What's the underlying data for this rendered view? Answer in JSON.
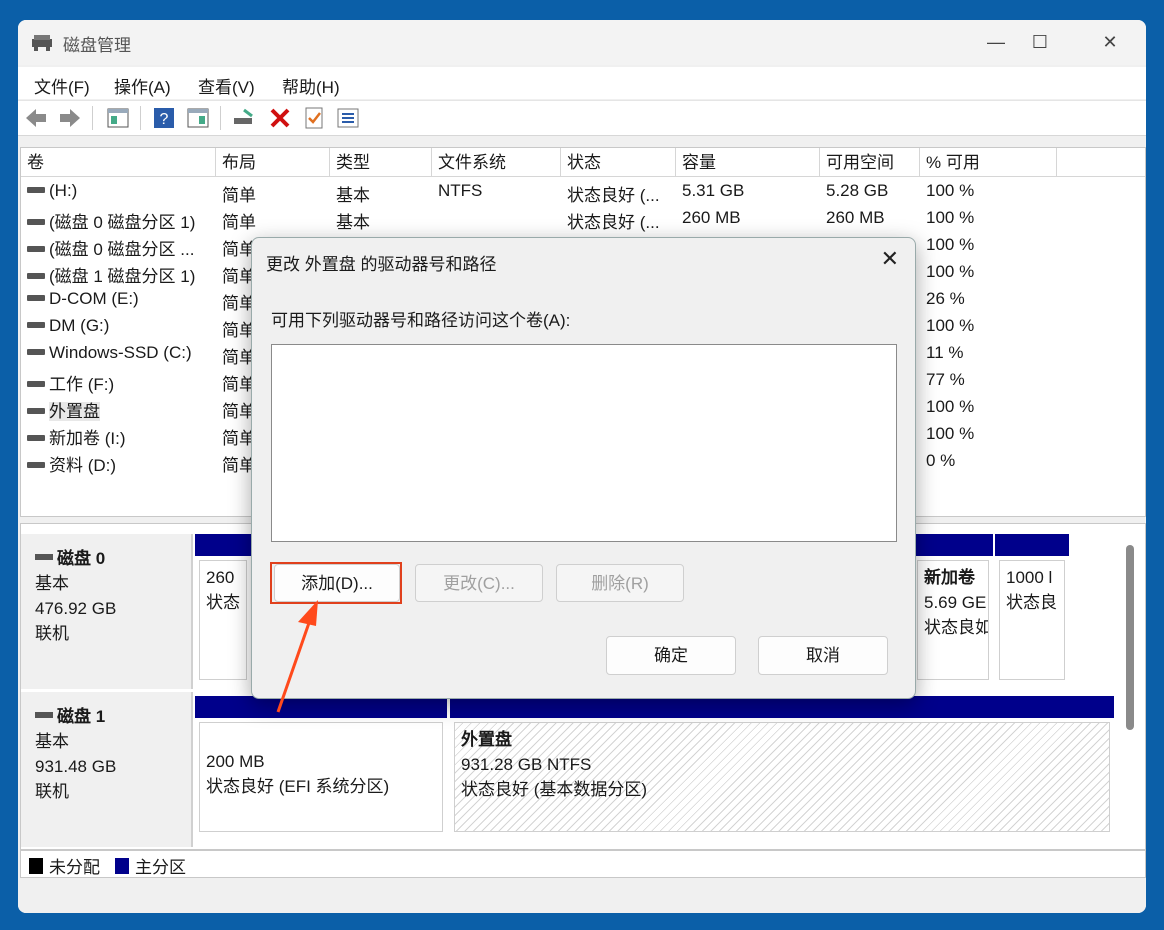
{
  "window": {
    "title": "磁盘管理",
    "minimize": "—",
    "maximize": "☐",
    "close": "✕"
  },
  "menu": [
    "文件(F)",
    "操作(A)",
    "查看(V)",
    "帮助(H)"
  ],
  "columns": [
    "卷",
    "布局",
    "类型",
    "文件系统",
    "状态",
    "容量",
    "可用空间",
    "% 可用"
  ],
  "volumes": [
    {
      "name": "(H:)",
      "layout": "简单",
      "type": "基本",
      "fs": "NTFS",
      "status": "状态良好 (...",
      "capacity": "5.31 GB",
      "free": "5.28 GB",
      "pct": "100 %"
    },
    {
      "name": "(磁盘 0 磁盘分区 1)",
      "layout": "简单",
      "type": "基本",
      "fs": "",
      "status": "状态良好 (...",
      "capacity": "260 MB",
      "free": "260 MB",
      "pct": "100 %"
    },
    {
      "name": "(磁盘 0 磁盘分区 ...",
      "layout": "简单",
      "type": "",
      "fs": "",
      "status": "",
      "capacity": "",
      "free": "",
      "pct": "100 %"
    },
    {
      "name": "(磁盘 1 磁盘分区 1)",
      "layout": "简单",
      "type": "",
      "fs": "",
      "status": "",
      "capacity": "",
      "free": "",
      "pct": "100 %"
    },
    {
      "name": "D-COM (E:)",
      "layout": "简单",
      "type": "",
      "fs": "",
      "status": "",
      "capacity": "",
      "free": "",
      "pct": "26 %"
    },
    {
      "name": "DM (G:)",
      "layout": "简单",
      "type": "",
      "fs": "",
      "status": "",
      "capacity": "",
      "free": "",
      "pct": "100 %"
    },
    {
      "name": "Windows-SSD (C:)",
      "layout": "简单",
      "type": "",
      "fs": "",
      "status": "",
      "capacity": "",
      "free": "",
      "pct": "11 %"
    },
    {
      "name": "工作 (F:)",
      "layout": "简单",
      "type": "",
      "fs": "",
      "status": "",
      "capacity": "",
      "free": "",
      "pct": "77 %"
    },
    {
      "name": "外置盘",
      "layout": "简单",
      "type": "",
      "fs": "",
      "status": "",
      "capacity": "",
      "free": "",
      "pct": "100 %"
    },
    {
      "name": "新加卷 (I:)",
      "layout": "简单",
      "type": "",
      "fs": "",
      "status": "",
      "capacity": "",
      "free": "",
      "pct": "100 %"
    },
    {
      "name": "资料 (D:)",
      "layout": "简单",
      "type": "",
      "fs": "",
      "status": "",
      "capacity": "",
      "free": "",
      "pct": "0 %"
    }
  ],
  "disk0": {
    "name": "磁盘 0",
    "type": "基本",
    "size": "476.92 GB",
    "state": "联机",
    "p1": {
      "l1": "260",
      "l2": "状态"
    },
    "p2": {
      "name": "新加卷",
      "l1": "5.69 GE",
      "l2": "状态良如"
    },
    "p3": {
      "l1": "1000 l",
      "l2": "状态良"
    }
  },
  "disk1": {
    "name": "磁盘 1",
    "type": "基本",
    "size": "931.48 GB",
    "state": "联机",
    "p1": {
      "l1": "200 MB",
      "l2": "状态良好 (EFI 系统分区)"
    },
    "p2": {
      "name": "外置盘",
      "l1": "931.28 GB NTFS",
      "l2": "状态良好 (基本数据分区)"
    }
  },
  "legend": {
    "unallocated": "未分配",
    "primary": "主分区"
  },
  "colors": {
    "primary": "#00008b",
    "unallocated": "#000000",
    "highlight": "#e0401c",
    "desktop": "#0b5fa8"
  },
  "dialog": {
    "title": "更改 外置盘 的驱动器号和路径",
    "label": "可用下列驱动器号和路径访问这个卷(A):",
    "add": "添加(D)...",
    "change": "更改(C)...",
    "remove": "删除(R)",
    "ok": "确定",
    "cancel": "取消"
  }
}
